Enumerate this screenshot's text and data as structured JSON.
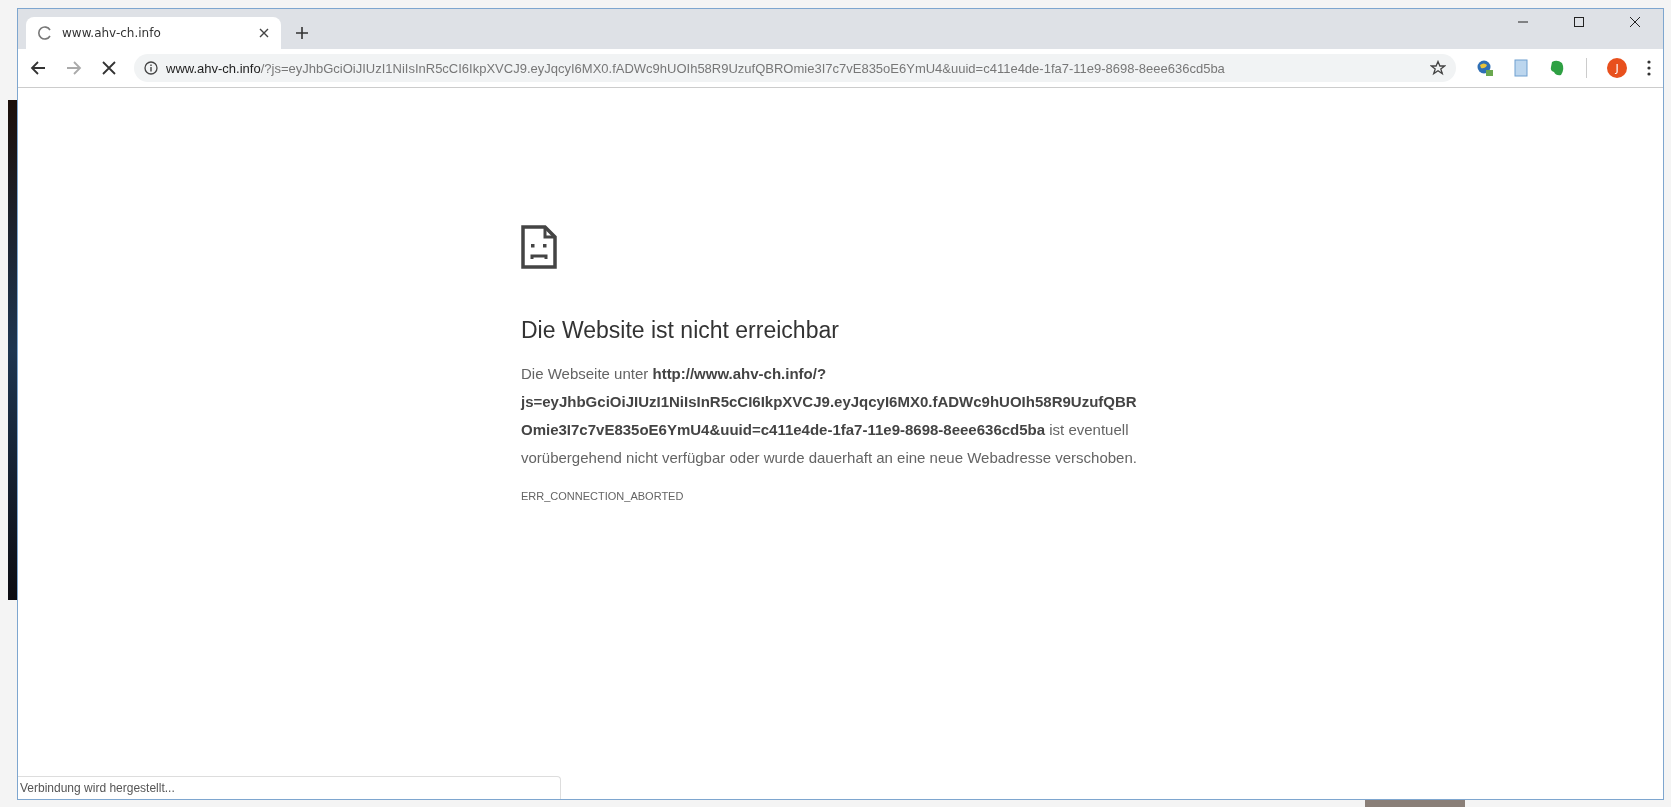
{
  "tabs": [
    {
      "title": "www.ahv-ch.info",
      "selected": true
    }
  ],
  "toolbar": {
    "back_disabled": false,
    "forward_disabled": true,
    "url_host": "www.ahv-ch.info",
    "url_path": "/?js=eyJhbGciOiJIUzI1NiIsInR5cCI6IkpXVCJ9.eyJqcyI6MX0.fADWc9hUOIh58R9UzufQBROmie3I7c7vE835oE6YmU4&uuid=c411e4de-1fa7-11e9-8698-8eee636cd5ba",
    "profile_initial": "J"
  },
  "error_page": {
    "heading": "Die Website ist nicht erreichbar",
    "message": "Die Webseite unter **http://www.ahv-ch.info/?js=eyJhbGciOiJIUzI1NiIsInR5cCI6IkpXVCJ9.eyJqcyI6MX0.fADWc9hUOIh58R9UzufQBROmie3I7c7vE835oE6YmU4&uuid=c411e4de-1fa7-11e9-8698-8eee636cd5ba** ist eventuell vorübergehend nicht verfügbar oder wurde dauerhaft an eine neue Webadresse verschoben.",
    "error_code": "ERR_CONNECTION_ABORTED"
  },
  "status_bubble": "Verbindung wird hergestellt..."
}
